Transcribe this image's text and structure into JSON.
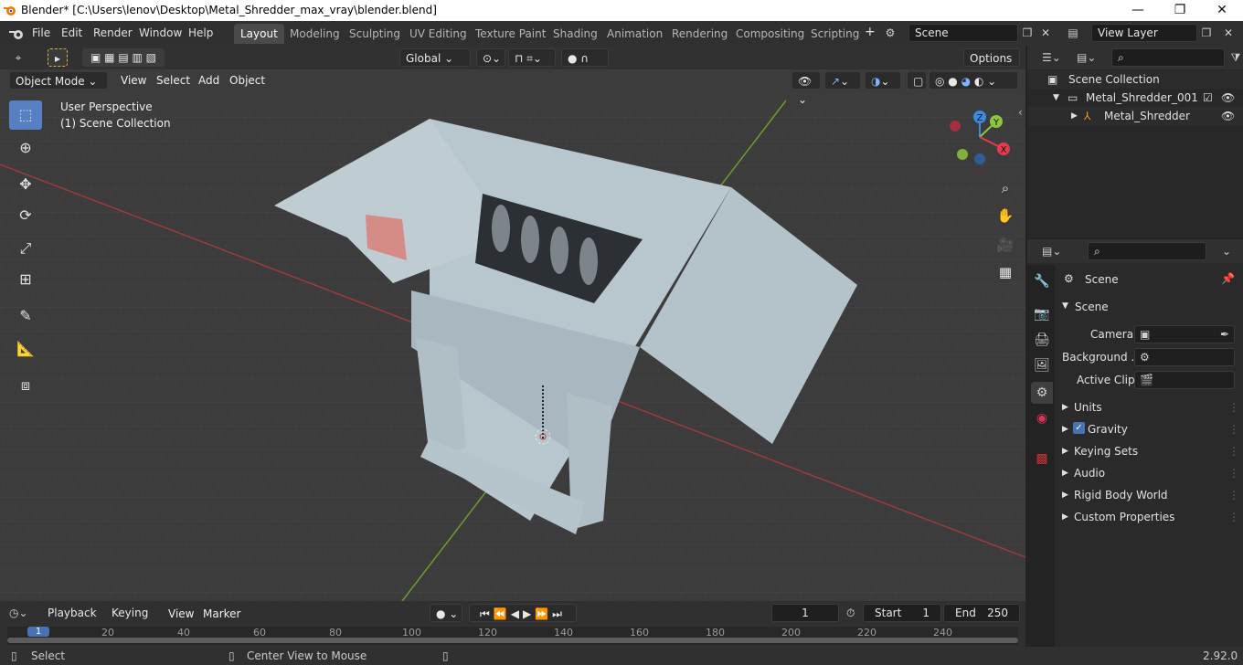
{
  "window": {
    "title": "Blender* [C:\\Users\\lenov\\Desktop\\Metal_Shredder_max_vray\\blender.blend]",
    "minimize": "—",
    "maximize": "❐",
    "close": "✕"
  },
  "menu": [
    "File",
    "Edit",
    "Render",
    "Window",
    "Help"
  ],
  "workspaces": [
    "Layout",
    "Modeling",
    "Sculpting",
    "UV Editing",
    "Texture Paint",
    "Shading",
    "Animation",
    "Rendering",
    "Compositing",
    "Scripting"
  ],
  "active_workspace": "Layout",
  "add_workspace": "+",
  "scene_field": "Scene",
  "view_layer_field": "View Layer",
  "viewport": {
    "transform_orientation": "Global",
    "options_label": "Options",
    "mode": "Object Mode",
    "header_menu": [
      "View",
      "Select",
      "Add",
      "Object"
    ],
    "overlay_text_1": "User Perspective",
    "overlay_text_2": "(1) Scene Collection",
    "gizmo": {
      "x": "X",
      "y": "Y",
      "z": "Z"
    }
  },
  "outliner": {
    "scene_collection": "Scene Collection",
    "collection": "Metal_Shredder_001",
    "object": "Metal_Shredder"
  },
  "properties": {
    "context_label": "Scene",
    "panel_title": "Scene",
    "camera_label": "Camera",
    "background_label": "Background ...",
    "active_clip_label": "Active Clip",
    "panels": [
      "Units",
      "Gravity",
      "Keying Sets",
      "Audio",
      "Rigid Body World",
      "Custom Properties"
    ],
    "gravity_checked": true
  },
  "timeline": {
    "menus": [
      "Playback",
      "Keying",
      "View",
      "Marker"
    ],
    "current_frame": "1",
    "start_label": "Start",
    "start_value": "1",
    "end_label": "End",
    "end_value": "250",
    "ruler_ticks": [
      "1",
      "20",
      "40",
      "60",
      "80",
      "100",
      "120",
      "140",
      "160",
      "180",
      "200",
      "220",
      "240"
    ]
  },
  "statusbar": {
    "select": "Select",
    "center_view": "Center View to Mouse",
    "version": "2.92.0"
  },
  "colors": {
    "accent": "#4772b3",
    "axis_x": "#e8394e",
    "axis_y": "#8cc63f",
    "axis_z": "#3b8ae6",
    "model": "#b8c6cd"
  }
}
